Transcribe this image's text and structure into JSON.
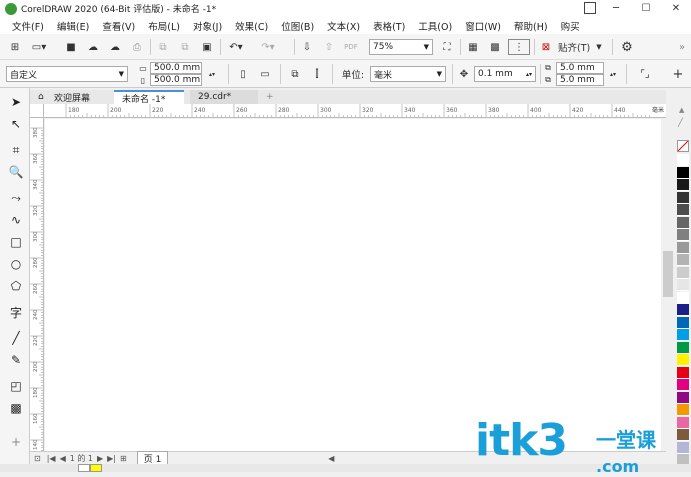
{
  "window": {
    "title": "CorelDRAW 2020 (64-Bit 评估版) - 未命名 -1*"
  },
  "menu": [
    "文件(F)",
    "编辑(E)",
    "查看(V)",
    "布局(L)",
    "对象(J)",
    "效果(C)",
    "位图(B)",
    "文本(X)",
    "表格(T)",
    "工具(O)",
    "窗口(W)",
    "帮助(H)",
    "购买"
  ],
  "toolbar1": {
    "zoom": "75%",
    "snap": "贴齐(T)"
  },
  "toolbar2": {
    "preset": "自定义",
    "width": "500.0 mm",
    "height": "500.0 mm",
    "unit_label": "单位:",
    "unit": "毫米",
    "nudge": "0.1 mm",
    "dup_x": "5.0 mm",
    "dup_y": "5.0 mm"
  },
  "tabs": [
    "欢迎屏幕",
    "未命名 -1*",
    "29.cdr*"
  ],
  "ruler": {
    "h_ticks": [
      "180",
      "200",
      "220",
      "240",
      "260",
      "280",
      "300",
      "320",
      "340",
      "360",
      "380",
      "400",
      "420",
      "440"
    ],
    "h_unit": "毫米",
    "v_ticks": [
      "380",
      "360",
      "340",
      "320",
      "300",
      "280",
      "260",
      "240",
      "220",
      "200",
      "180",
      "160",
      "140"
    ]
  },
  "pages": {
    "counter": "1 的 1",
    "current_page": "页 1"
  },
  "palette": [
    "#ffffff",
    "#000000",
    "#1a1a1a",
    "#333333",
    "#4d4d4d",
    "#666666",
    "#808080",
    "#999999",
    "#b3b3b3",
    "#cccccc",
    "#e6e6e6",
    "#ffffff",
    "#1d2088",
    "#0068b7",
    "#00a0e9",
    "#009944",
    "#fff100",
    "#e60012",
    "#e4007f",
    "#920783",
    "#f39800",
    "#ea68a2",
    "#7d5a3c",
    "#b5b5d6",
    "#c0c0c0"
  ],
  "watermark": {
    "main": "itk3",
    "sub": "一堂课",
    "domain": ".com"
  }
}
